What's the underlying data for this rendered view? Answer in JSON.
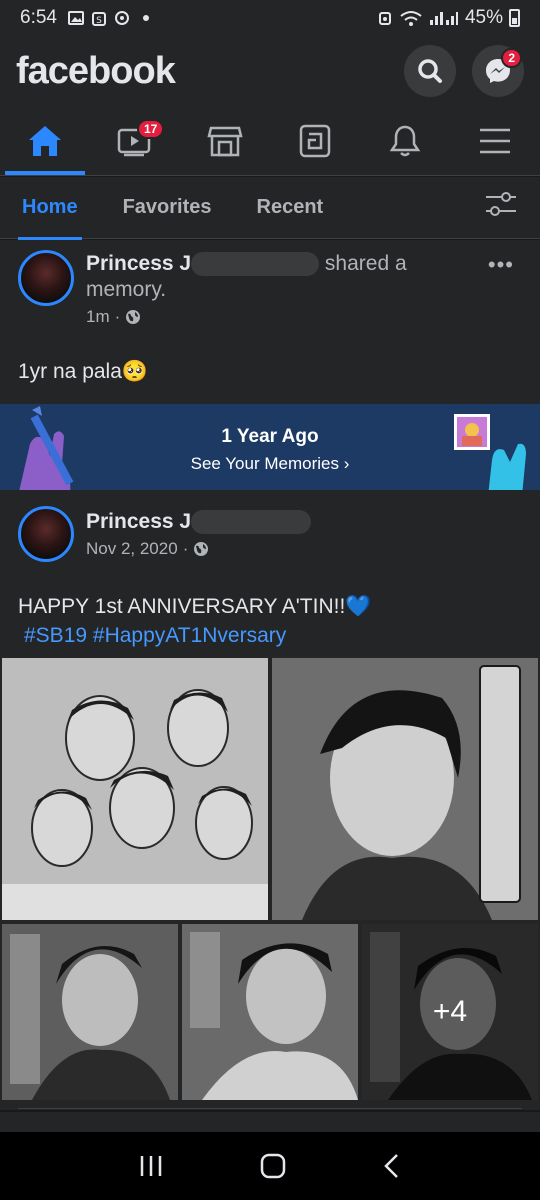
{
  "status": {
    "time": "6:54",
    "battery": "45%"
  },
  "header": {
    "logo": "facebook",
    "messenger_badge": "2"
  },
  "nav": {
    "watch_badge": "17"
  },
  "filter": {
    "tabs": [
      "Home",
      "Favorites",
      "Recent"
    ]
  },
  "post1": {
    "name": "Princess J",
    "action_suffix": "shared a",
    "action_line2": "memory.",
    "time": "1m",
    "text": "1yr na pala🥺",
    "memory_title": "1 Year Ago",
    "memory_link": "See Your Memories"
  },
  "post2": {
    "name": "Princess J",
    "date": "Nov 2, 2020",
    "text": "HAPPY 1st ANNIVERSARY A'TIN!!💙",
    "hashtags": [
      "#SB19",
      "#HappyAT1Nversary"
    ],
    "more_photos": "+4"
  },
  "colors": {
    "accent": "#2d88ff",
    "badge": "#e41e3f",
    "card": "#242526",
    "memory_banner": "#1c3a63"
  }
}
